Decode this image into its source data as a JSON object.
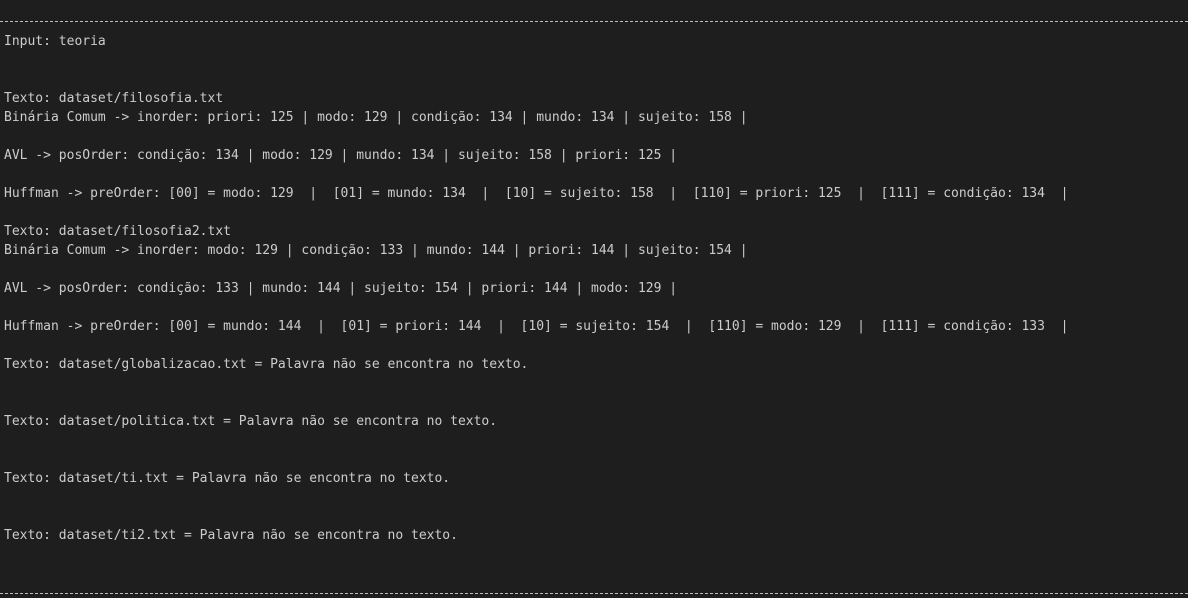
{
  "terminal": {
    "separator_top": "---",
    "lines": [
      "Input: teoria",
      "Texto: dataset/filosofia.txt",
      "Binária Comum -> inorder: priori: 125 | modo: 129 | condição: 134 | mundo: 134 | sujeito: 158 |",
      "AVL -> posOrder: condição: 134 | modo: 129 | mundo: 134 | sujeito: 158 | priori: 125 |",
      "Huffman -> preOrder: [00] = modo: 129  |  [01] = mundo: 134  |  [10] = sujeito: 158  |  [110] = priori: 125  |  [111] = condição: 134  |",
      "Texto: dataset/filosofia2.txt",
      "Binária Comum -> inorder: modo: 129 | condição: 133 | mundo: 144 | priori: 144 | sujeito: 154 |",
      "AVL -> posOrder: condição: 133 | mundo: 144 | sujeito: 154 | priori: 144 | modo: 129 |",
      "Huffman -> preOrder: [00] = mundo: 144  |  [01] = priori: 144  |  [10] = sujeito: 154  |  [110] = modo: 129  |  [111] = condição: 133  |",
      "Texto: dataset/globalizacao.txt = Palavra não se encontra no texto.",
      "Texto: dataset/politica.txt = Palavra não se encontra no texto.",
      "Texto: dataset/ti.txt = Palavra não se encontra no texto.",
      "Texto: dataset/ti2.txt = Palavra não se encontra no texto."
    ]
  },
  "colors": {
    "background": "#1e1e1e",
    "text": "#cccccc"
  }
}
